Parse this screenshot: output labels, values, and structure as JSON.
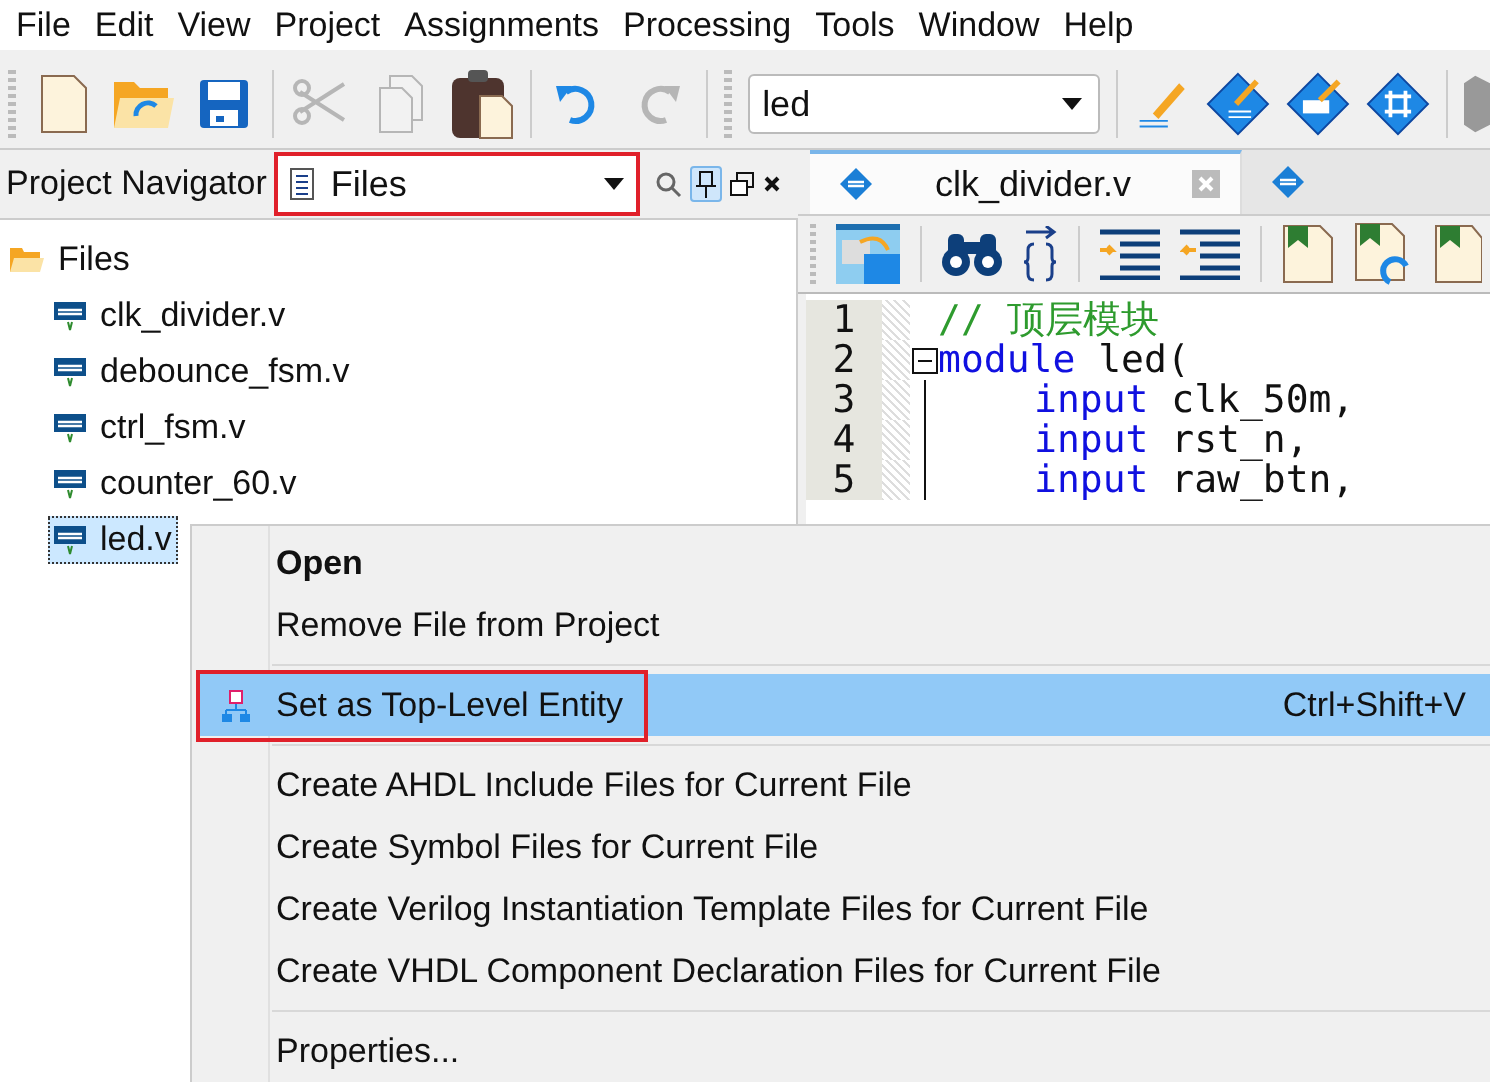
{
  "menu_bar": [
    "File",
    "Edit",
    "View",
    "Project",
    "Assignments",
    "Processing",
    "Tools",
    "Window",
    "Help"
  ],
  "toolbar": {
    "items": [
      {
        "kind": "new",
        "disabled": false
      },
      {
        "kind": "open",
        "disabled": false
      },
      {
        "kind": "save",
        "disabled": false
      },
      {
        "kind": "separator",
        "disabled": false
      },
      {
        "kind": "cut",
        "disabled": true
      },
      {
        "kind": "copy",
        "disabled": true
      },
      {
        "kind": "paste",
        "disabled": false
      },
      {
        "kind": "separator",
        "disabled": false
      },
      {
        "kind": "undo",
        "disabled": false
      },
      {
        "kind": "redo",
        "disabled": true
      }
    ],
    "project_combo": {
      "value": "led"
    }
  },
  "project_navigator": {
    "title": "Project Navigator",
    "view_dropdown": {
      "value": "Files",
      "annotated": true
    },
    "tree": [
      {
        "label": "Files",
        "kind": "folder",
        "expanded": true,
        "selected": false,
        "children": [
          {
            "label": "clk_divider.v",
            "kind": "file",
            "selected": false
          },
          {
            "label": "debounce_fsm.v",
            "kind": "file",
            "selected": false
          },
          {
            "label": "ctrl_fsm.v",
            "kind": "file",
            "selected": false
          },
          {
            "label": "counter_60.v",
            "kind": "file",
            "selected": false
          },
          {
            "label": "led.v",
            "kind": "file",
            "selected": true
          }
        ]
      }
    ]
  },
  "editor": {
    "tabs": [
      {
        "label": "clk_divider.v",
        "selected": true
      },
      {
        "selected": false
      }
    ],
    "lines": [
      {
        "number": "1",
        "fold": false,
        "indent": false,
        "tokens": [
          {
            "kind": "comment",
            "text": "// 顶层模块"
          }
        ]
      },
      {
        "number": "2",
        "fold": true,
        "indent": false,
        "tokens": [
          {
            "kind": "keyword",
            "text": "module"
          },
          {
            "kind": "plain",
            "text": " led("
          }
        ]
      },
      {
        "number": "3",
        "fold": false,
        "indent": true,
        "tokens": [
          {
            "kind": "keyword",
            "text": "input"
          },
          {
            "kind": "plain",
            "text": " clk_50m,"
          }
        ]
      },
      {
        "number": "4",
        "fold": false,
        "indent": true,
        "tokens": [
          {
            "kind": "keyword",
            "text": "input"
          },
          {
            "kind": "plain",
            "text": " rst_n,"
          }
        ]
      },
      {
        "number": "5",
        "fold": false,
        "indent": true,
        "tokens": [
          {
            "kind": "keyword",
            "text": "input"
          },
          {
            "kind": "plain",
            "text": " raw_btn,"
          }
        ]
      }
    ]
  },
  "context_menu": {
    "items": [
      {
        "kind": "item",
        "label": "Open",
        "bold": true,
        "selected": false,
        "annotated": false
      },
      {
        "kind": "item",
        "label": "Remove File from Project",
        "bold": false,
        "selected": false,
        "annotated": false
      },
      {
        "kind": "separator"
      },
      {
        "kind": "entity_item",
        "label": "Set as Top-Level Entity",
        "bold": false,
        "selected": true,
        "annotated": true,
        "shortcut": "Ctrl+Shift+V"
      },
      {
        "kind": "separator"
      },
      {
        "kind": "item",
        "label": "Create AHDL Include Files for Current File",
        "bold": false,
        "selected": false,
        "annotated": false
      },
      {
        "kind": "item",
        "label": "Create Symbol Files for Current File",
        "bold": false,
        "selected": false,
        "annotated": false
      },
      {
        "kind": "item",
        "label": "Create Verilog Instantiation Template Files for Current File",
        "bold": false,
        "selected": false,
        "annotated": false
      },
      {
        "kind": "item",
        "label": "Create VHDL Component Declaration Files for Current File",
        "bold": false,
        "selected": false,
        "annotated": false
      },
      {
        "kind": "separator"
      },
      {
        "kind": "item",
        "label": "Properties...",
        "bold": false,
        "selected": false,
        "annotated": false
      }
    ]
  }
}
